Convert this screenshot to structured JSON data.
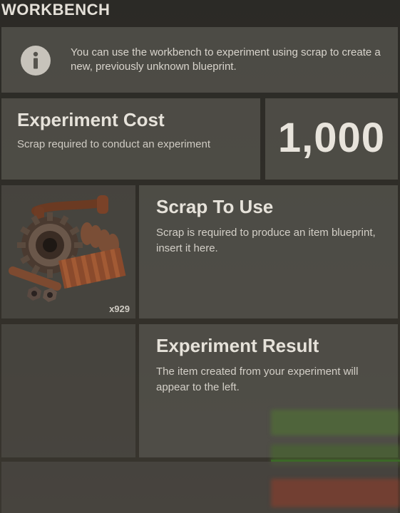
{
  "header": {
    "title": "WORKBENCH"
  },
  "info": {
    "icon": "info-icon",
    "text": "You can use the workbench to experiment using scrap to create a new, previously unknown blueprint."
  },
  "cost": {
    "title": "Experiment Cost",
    "subtitle": "Scrap required to conduct an experiment",
    "value": "1,000"
  },
  "scrap_slot": {
    "item_icon": "scrap-icon",
    "count": "x929"
  },
  "scrap_to_use": {
    "title": "Scrap To Use",
    "description": "Scrap is required to produce an item blueprint, insert it here."
  },
  "result": {
    "title": "Experiment Result",
    "description": "The item created from your experiment will appear to the left."
  },
  "colors": {
    "panel": "#56544e",
    "text": "#e6e2da",
    "ghost_green": "#507832",
    "ghost_red": "#963c28"
  }
}
